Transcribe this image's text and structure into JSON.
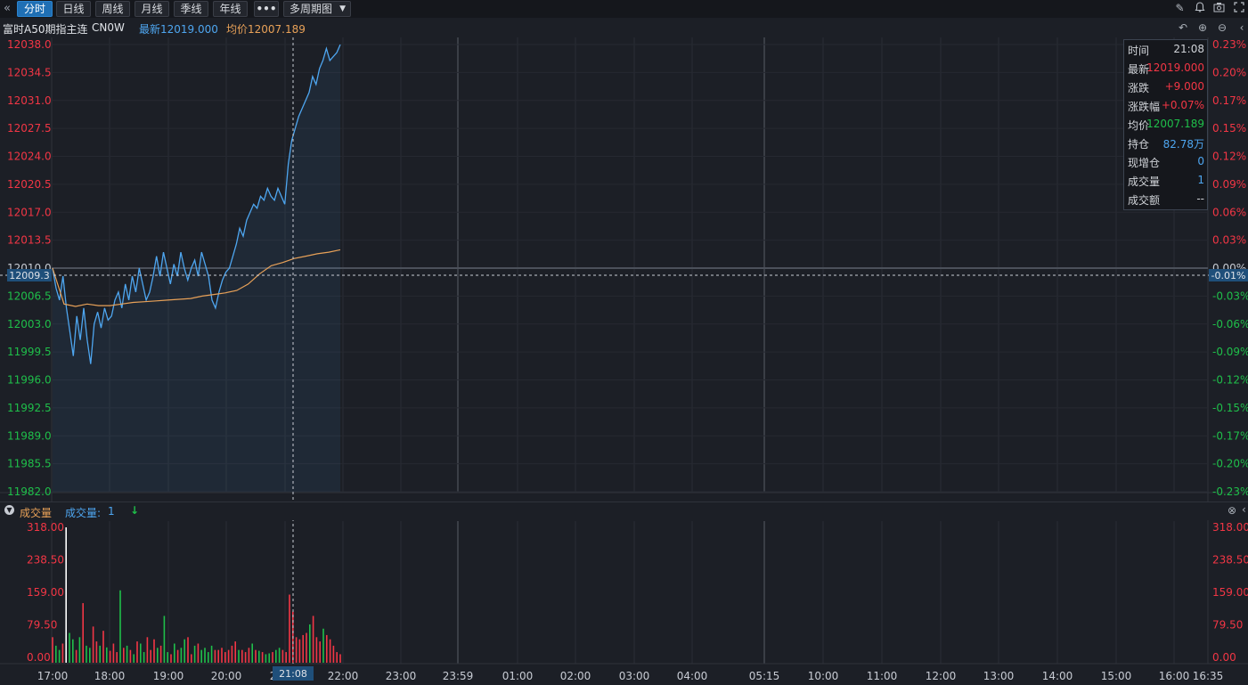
{
  "toolbar": {
    "back_icon": "double-chevron-left-icon",
    "buttons": [
      {
        "label": "分时",
        "active": true
      },
      {
        "label": "日线",
        "active": false
      },
      {
        "label": "周线",
        "active": false
      },
      {
        "label": "月线",
        "active": false
      },
      {
        "label": "季线",
        "active": false
      },
      {
        "label": "年线",
        "active": false
      },
      {
        "label": "•••",
        "active": false
      }
    ],
    "dropdown_label": "多周期图",
    "icons": [
      "pencil-icon",
      "bell-icon",
      "camera-icon",
      "fullscreen-icon"
    ]
  },
  "header": {
    "instrument": "富时A50期指主连",
    "code": "CN0W",
    "latest": "最新12019.000",
    "avg": "均价12007.189",
    "icons": [
      "undo-icon",
      "zoom-in-icon",
      "zoom-out-icon",
      "chevron-left-icon"
    ]
  },
  "colors": {
    "up": "#f23645",
    "down": "#1fbf4a",
    "price_line": "#4ea6f0",
    "avg_line": "#e8a158",
    "volume_label": "#e8a158",
    "blue_text": "#4ea6f0"
  },
  "price_axis": {
    "left_labels": [
      "12038.0",
      "12034.5",
      "12031.0",
      "12027.5",
      "12024.0",
      "12020.5",
      "12017.0",
      "12013.5",
      "12010.0",
      "12006.5",
      "12003.0",
      "11999.5",
      "11996.0",
      "11992.5",
      "11989.0",
      "11985.5",
      "11982.0"
    ],
    "right_labels": [
      "0.23%",
      "0.20%",
      "0.17%",
      "0.15%",
      "0.12%",
      "0.09%",
      "0.06%",
      "0.03%",
      "0.00%",
      "-0.03%",
      "-0.06%",
      "-0.09%",
      "-0.12%",
      "-0.15%",
      "-0.17%",
      "-0.20%",
      "-0.23%"
    ],
    "min": 11982.0,
    "max": 12038.0,
    "base": 12010.0,
    "crosshair_price": "12009.3",
    "crosshair_pct": "-0.01%"
  },
  "info_panel": [
    {
      "label": "时间",
      "value": "21:08",
      "color": "#d0d3d8"
    },
    {
      "label": "最新",
      "value": "12019.000",
      "color": "#f23645"
    },
    {
      "label": "涨跌",
      "value": "+9.000",
      "color": "#f23645"
    },
    {
      "label": "涨跌幅",
      "value": "+0.07%",
      "color": "#f23645"
    },
    {
      "label": "均价",
      "value": "12007.189",
      "color": "#1fbf4a"
    },
    {
      "label": "持仓",
      "value": "82.78万",
      "color": "#4ea6f0"
    },
    {
      "label": "现增仓",
      "value": "0",
      "color": "#4ea6f0"
    },
    {
      "label": "成交量",
      "value": "1",
      "color": "#4ea6f0"
    },
    {
      "label": "成交额",
      "value": "--",
      "color": "#d0d3d8"
    }
  ],
  "volume_panel": {
    "title": "成交量",
    "series_label": "成交量: ",
    "series_value": "1",
    "arrow_icon": "arrow-down-icon",
    "close_icon": "close-circle-icon",
    "collapse_icon": "collapse-icon",
    "labels": [
      "318.00",
      "238.50",
      "159.00",
      "79.50",
      "0.00"
    ],
    "max": 318.0
  },
  "time_axis": {
    "labels": [
      "17:00",
      "18:00",
      "19:00",
      "20:00",
      "21:00",
      "22:00",
      "23:00",
      "23:59",
      "01:00",
      "02:00",
      "03:00",
      "04:00",
      "05:15",
      "10:00",
      "11:00",
      "12:00",
      "13:00",
      "14:00",
      "15:00",
      "16:00",
      "16:35"
    ],
    "crosshair_time": "21:08"
  },
  "chart_data": {
    "type": "line",
    "title": "",
    "series": [
      {
        "values": [
          12010,
          12007.5,
          12006,
          12009,
          12005,
          12002,
          11999,
          12004,
          12001,
          12005,
          12001,
          11998,
          12003,
          12004.5,
          12002.5,
          12005,
          12003.5,
          12004,
          12006,
          12007,
          12005,
          12008,
          12006,
          12009,
          12007,
          12010,
          12008,
          12006,
          12007,
          12009,
          12011.5,
          12009,
          12012,
          12010,
          12008,
          12010.5,
          12009,
          12012,
          12010,
          12008.5,
          12010,
          12011,
          12009,
          12012,
          12010.5,
          12009,
          12006,
          12005,
          12007,
          12008.5,
          12009.5,
          12010,
          12011.5,
          12013,
          12015,
          12014,
          12016,
          12017,
          12018,
          12017.5,
          12019,
          12018.5,
          12020,
          12019,
          12018.5,
          12020,
          12019,
          12018,
          12023,
          12026,
          12027.5,
          12029,
          12030,
          12031,
          12032,
          12034,
          12033,
          12035,
          12036,
          12037.5,
          12036,
          12036.5,
          12037,
          12038
        ]
      },
      {
        "values": [
          12010,
          12005.5,
          12005.2,
          12005.5,
          12005.3,
          12005.3,
          12005.5,
          12005.7,
          12005.8,
          12005.9,
          12006.0,
          12006.1,
          12006.2,
          12006.5,
          12006.7,
          12006.9,
          12007.2,
          12008.0,
          12009.3,
          12010.3,
          12010.7,
          12011.2,
          12011.5,
          12011.8,
          12012.0,
          12012.3
        ]
      }
    ],
    "volumes": [
      60,
      40,
      30,
      45,
      318,
      70,
      55,
      30,
      60,
      140,
      40,
      35,
      85,
      50,
      40,
      75,
      36,
      28,
      45,
      25,
      170,
      35,
      40,
      30,
      20,
      50,
      45,
      25,
      60,
      30,
      55,
      35,
      40,
      110,
      25,
      20,
      45,
      30,
      35,
      55,
      60,
      20,
      40,
      45,
      30,
      35,
      25,
      40,
      30,
      30,
      35,
      25,
      30,
      40,
      50,
      30,
      30,
      25,
      35,
      45,
      30,
      28,
      25,
      20,
      22,
      25,
      30,
      35,
      30,
      25,
      160,
      120,
      60,
      55,
      65,
      70,
      90,
      110,
      60,
      50,
      80,
      65,
      55,
      40,
      25,
      20
    ],
    "ylim": [
      11982.0,
      12038.0
    ]
  }
}
